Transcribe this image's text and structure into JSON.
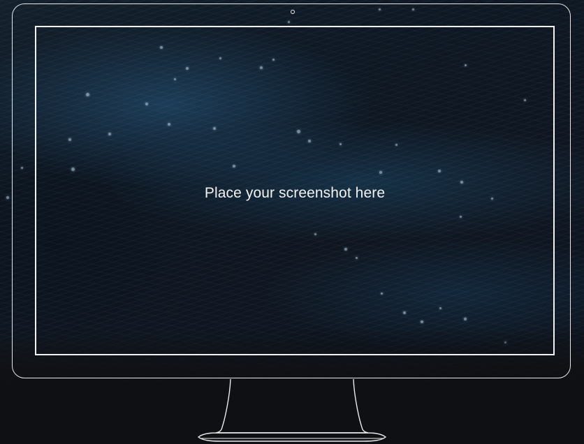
{
  "screen": {
    "caption": "Place your screenshot here"
  },
  "icons": {
    "camera": "camera-dot-icon"
  },
  "colors": {
    "background": "#0f1013",
    "outline": "#eeeeee",
    "caption_text": "#f2f2f2"
  }
}
